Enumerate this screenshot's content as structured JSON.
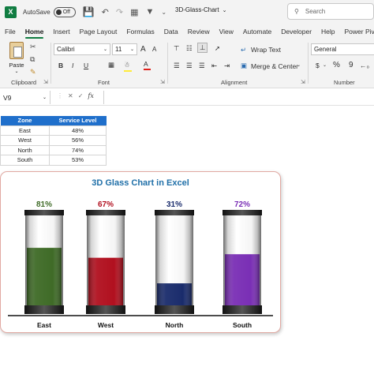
{
  "titlebar": {
    "app_icon": "excel-logo",
    "autosave_label": "AutoSave",
    "autosave_state": "Off",
    "file_name": "3D-Glass-Chart",
    "search_placeholder": "Search"
  },
  "tabs": [
    "File",
    "Home",
    "Insert",
    "Page Layout",
    "Formulas",
    "Data",
    "Review",
    "View",
    "Automate",
    "Developer",
    "Help",
    "Power Pivot"
  ],
  "active_tab": "Home",
  "ribbon": {
    "clipboard": {
      "paste_label": "Paste",
      "group_label": "Clipboard"
    },
    "font": {
      "name": "Calibri",
      "size": "11",
      "group_label": "Font",
      "bold": "B",
      "italic": "I",
      "underline": "U",
      "grow": "A",
      "shrink": "A"
    },
    "alignment": {
      "wrap_text": "Wrap Text",
      "merge_center": "Merge & Center",
      "group_label": "Alignment"
    },
    "number": {
      "format": "General",
      "group_label": "Number",
      "currency": "$",
      "percent": "%",
      "comma": "9"
    }
  },
  "formula_bar": {
    "cell_ref": "V9",
    "fx": "fx",
    "value": ""
  },
  "table": {
    "headers": [
      "Zone",
      "Service Level"
    ],
    "rows": [
      [
        "East",
        "48%"
      ],
      [
        "West",
        "56%"
      ],
      [
        "North",
        "74%"
      ],
      [
        "South",
        "53%"
      ]
    ],
    "header_color": "#1f6fcb"
  },
  "chart_data": {
    "type": "bar",
    "title": "3D Glass Chart in Excel",
    "categories": [
      "East",
      "West",
      "North",
      "South"
    ],
    "values": [
      81,
      67,
      31,
      72
    ],
    "labels": [
      "81%",
      "67%",
      "31%",
      "72%"
    ],
    "colors": [
      "#3f6b27",
      "#b1101f",
      "#1a2c6c",
      "#7a2fb5"
    ],
    "ylim": [
      0,
      100
    ]
  }
}
